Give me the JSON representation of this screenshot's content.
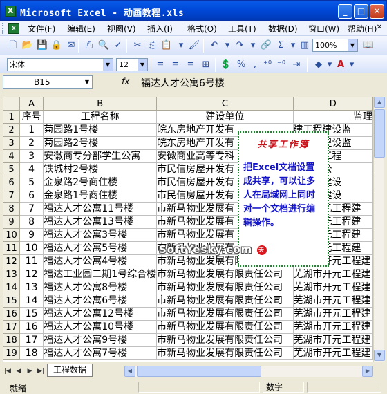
{
  "window": {
    "title": "Microsoft Excel - 动画教程.xls",
    "app_icon_label": "X"
  },
  "menu": [
    "文件(F)",
    "编辑(E)",
    "视图(V)",
    "插入(I)",
    "格式(O)",
    "工具(T)",
    "数据(D)",
    "窗口(W)",
    "帮助(H)"
  ],
  "toolbar": {
    "zoom": "100%"
  },
  "format_toolbar": {
    "font": "宋体",
    "size": "12"
  },
  "formula_bar": {
    "cell_ref": "B15",
    "fx_label": "fx",
    "content": "福达人才公寓6号楼"
  },
  "columns": [
    "A",
    "B",
    "C",
    "D"
  ],
  "header_row": {
    "row_num": "1",
    "col_a": "序号",
    "col_b": "工程名称",
    "col_c": "建设单位",
    "col_d": "监理"
  },
  "rows": [
    {
      "r": "2",
      "a": "1",
      "b": "菊园路1号楼",
      "c": "皖东房地产开发有",
      "d": "建工程建设监"
    },
    {
      "r": "3",
      "a": "2",
      "b": "菊园路2号楼",
      "c": "皖东房地产开发有",
      "d": "建工程建设监"
    },
    {
      "r": "4",
      "a": "3",
      "b": "安徽商专分部学生公寓",
      "c": "安徽商业高等专科",
      "d": "山建设工程"
    },
    {
      "r": "5",
      "a": "4",
      "b": "铁城村2号楼",
      "c": "市民信房屋开发有",
      "d": "设监理公"
    },
    {
      "r": "6",
      "a": "5",
      "b": "金泉路2号商住楼",
      "c": "市民信房屋开发有",
      "d": "县姑孰建设"
    },
    {
      "r": "7",
      "a": "6",
      "b": "金泉路1号商住楼",
      "c": "市民信房屋开发有",
      "d": "县姑孰建设"
    },
    {
      "r": "8",
      "a": "7",
      "b": "福达人才公寓11号楼",
      "c": "市新马物业发展有",
      "d": "湖市开元工程建"
    },
    {
      "r": "9",
      "a": "8",
      "b": "福达人才公寓13号楼",
      "c": "市新马物业发展有",
      "d": "湖市开元工程建"
    },
    {
      "r": "10",
      "a": "9",
      "b": "福达人才公寓3号楼",
      "c": "市新马物业发展有",
      "d": "湖市开元工程建"
    },
    {
      "r": "11",
      "a": "10",
      "b": "福达人才公寓5号楼",
      "c": "市新马物业发展有",
      "d": "湖市开元工程建"
    },
    {
      "r": "12",
      "a": "11",
      "b": "福达人才公寓4号楼",
      "c": "市新马物业发展有限责任公司",
      "d": "芜湖市开元工程建"
    },
    {
      "r": "13",
      "a": "12",
      "b": "福达工业园二期1号综合楼",
      "c": "市新马物业发展有限责任公司",
      "d": "芜湖市开元工程建"
    },
    {
      "r": "14",
      "a": "13",
      "b": "福达人才公寓8号楼",
      "c": "市新马物业发展有限责任公司",
      "d": "芜湖市开元工程建"
    },
    {
      "r": "15",
      "a": "14",
      "b": "福达人才公寓6号楼",
      "c": "市新马物业发展有限责任公司",
      "d": "芜湖市开元工程建"
    },
    {
      "r": "16",
      "a": "15",
      "b": "福达人才公寓12号楼",
      "c": "市新马物业发展有限责任公司",
      "d": "芜湖市开元工程建"
    },
    {
      "r": "17",
      "a": "16",
      "b": "福达人才公寓10号楼",
      "c": "市新马物业发展有限责任公司",
      "d": "芜湖市开元工程建"
    },
    {
      "r": "18",
      "a": "17",
      "b": "福达人才公寓9号楼",
      "c": "市新马物业发展有限责任公司",
      "d": "芜湖市开元工程建"
    },
    {
      "r": "19",
      "a": "18",
      "b": "福达人才公寓7号楼",
      "c": "市新马物业发展有限责任公司",
      "d": "芜湖市开元工程建"
    }
  ],
  "comment": {
    "title": "共享工作簿",
    "body": "把Excel文档设置成共享，可以让多人在局域网上同时对一个文档进行编辑操作。"
  },
  "watermark": {
    "text": "SoftYesky.com",
    "badge": "天极"
  },
  "sheet_tab": "工程数据",
  "status": {
    "ready": "就绪",
    "mode": "数字"
  }
}
